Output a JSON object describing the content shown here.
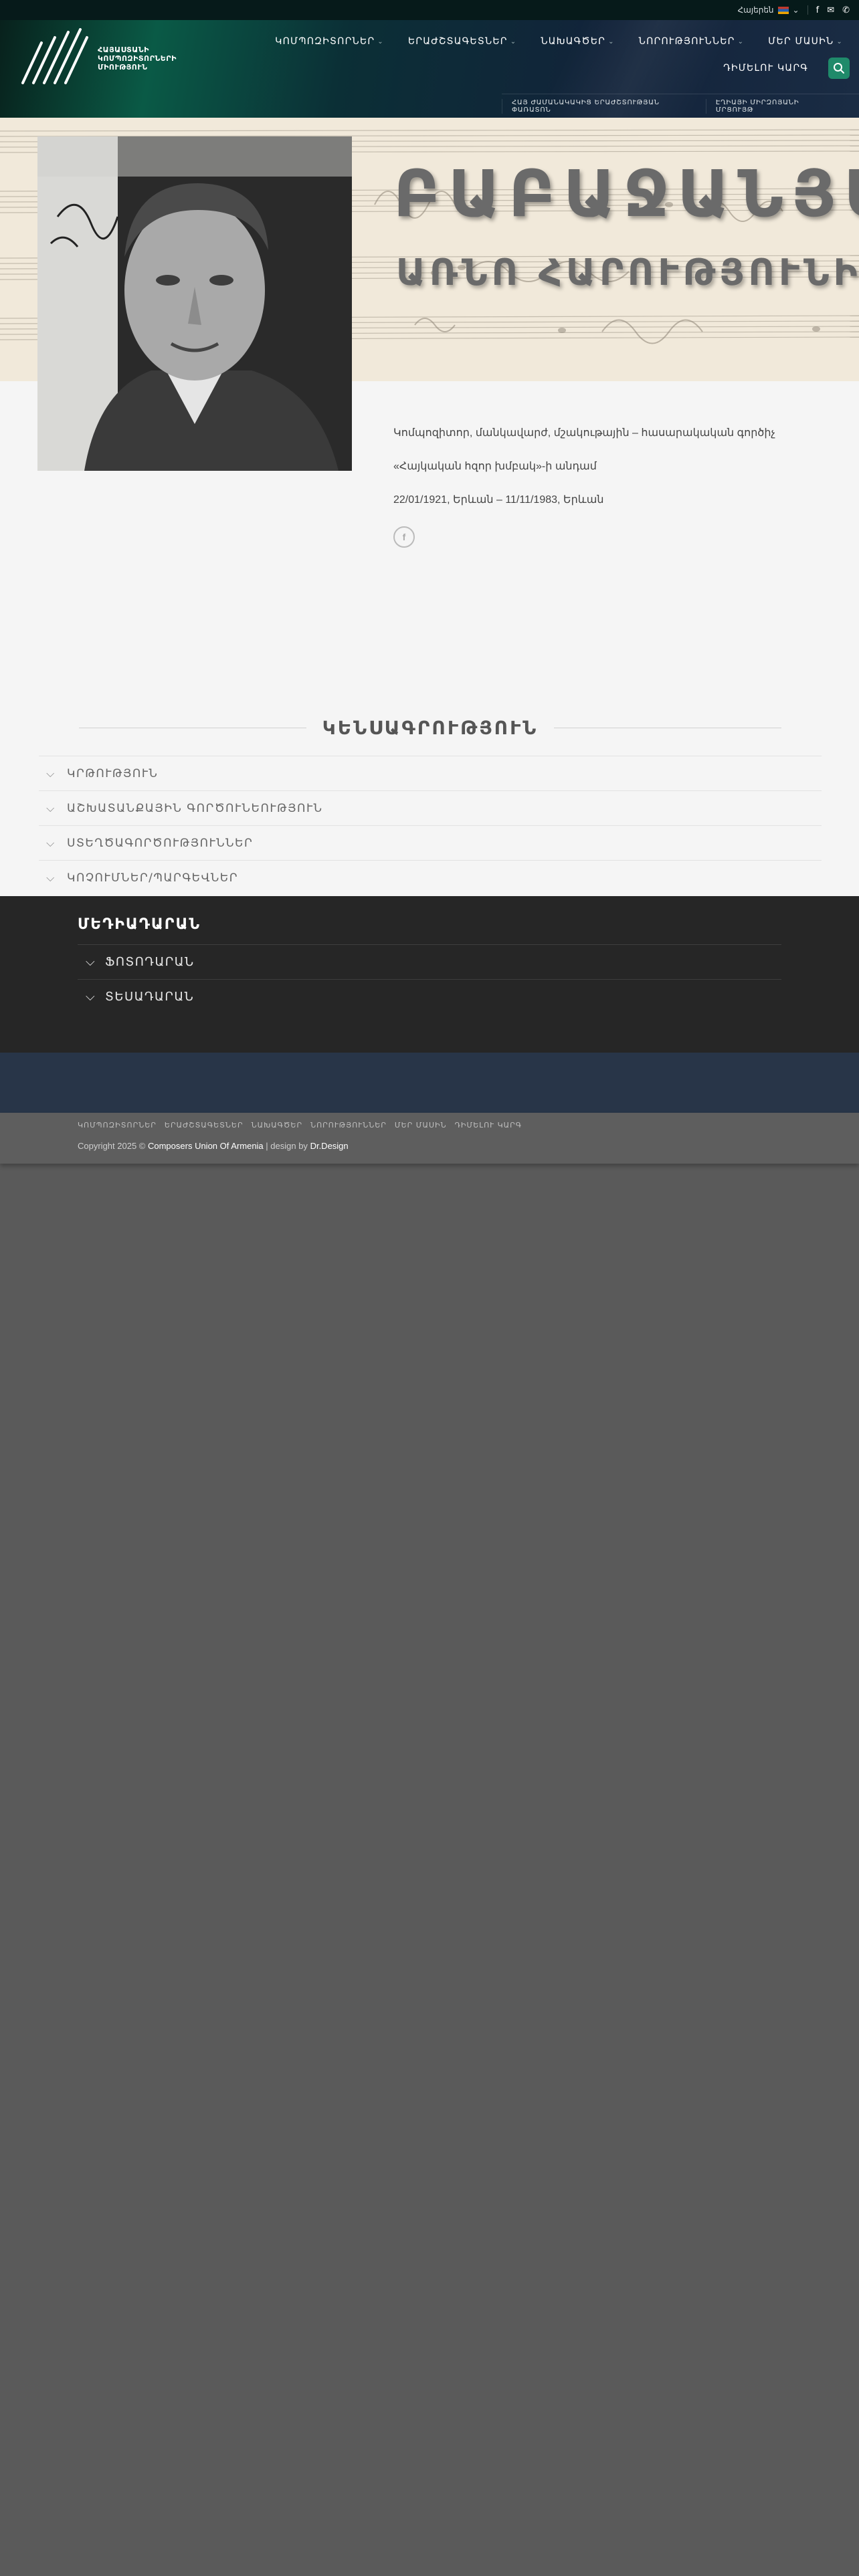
{
  "topbar": {
    "language": "Հայերեն",
    "icons": [
      "facebook-icon",
      "mail-icon",
      "phone-icon"
    ]
  },
  "logo": {
    "text_line1": "ՀԱՅԱՍՏԱՆԻ",
    "text_line2": "ԿՈՄՊՈԶԻՏՈՐՆԵՐԻ",
    "text_line3": "ՄԻՈՒԹՅՈՒՆ"
  },
  "nav": {
    "items": [
      {
        "label": "ԿՈՄՊՈԶԻՏՈՐՆԵՐ"
      },
      {
        "label": "ԵՐԱԺՇՏԱԳԵՏՆԵՐ"
      },
      {
        "label": "ՆԱԽԱԳԾԵՐ"
      },
      {
        "label": "ՆՈՐՈՒԹՅՈՒՆՆԵՐ"
      },
      {
        "label": "ՄԵՐ ՄԱՍԻՆ"
      }
    ],
    "contact_label": "ԴԻՄԵԼՈՒ ԿԱՐԳ",
    "subnav": [
      "ՀԱՅ ԺԱՄԱՆԱԿԱԿԻՑ ԵՐԱԺՇՏՈՒԹՅԱՆ ՓԱՌԱՏՈՆ",
      "ԷՂԻԱՅԻ ՄԻՐԶՈՅԱՆԻ ՄՐՑՈՒՅԹ"
    ]
  },
  "hero": {
    "surname": "ԲԱԲԱՋԱՆՅԱՆ",
    "given_name": "ԱՌՆՈ ՀԱՐՈՒԹՅՈՒՆԻ"
  },
  "info": {
    "line1": "Կոմպոզիտոր, մանկավարժ, մշակութային – հասարակական գործիչ",
    "line2": "«Հայկական հզոր խմբակ»-ի անդամ",
    "dates": "22/01/1921, Երևան – 11/11/1983, Երևան",
    "share_label": "f"
  },
  "biography": {
    "title": "ԿԵՆՍԱԳՐՈՒԹՅՈՒՆ",
    "sections": [
      {
        "label": "ԿՐԹՈՒԹՅՈՒՆ"
      },
      {
        "label": "ԱՇԽԱՏԱՆՔԱՅԻՆ ԳՈՐԾՈՒՆԵՈՒԹՅՈՒՆ"
      },
      {
        "label": "ՍՏԵՂԾԱԳՈՐԾՈՒԹՅՈՒՆՆԵՐ"
      },
      {
        "label": "ԿՈՉՈՒՄՆԵՐ/ՊԱՐԳԵՎՆԵՐ"
      }
    ]
  },
  "media": {
    "title": "ՄԵԴԻԱԴԱՐԱՆ",
    "sections": [
      {
        "label": "ՖՈՏՈԴԱՐԱՆ"
      },
      {
        "label": "ՏԵՍԱԴԱՐԱՆ"
      }
    ]
  },
  "footer": {
    "links": [
      "ԿՈՄՊՈԶԻՏՈՐՆԵՐ",
      "ԵՐԱԺՇՏԱԳԵՏՆԵՐ",
      "ՆԱԽԱԳԾԵՐ",
      "ՆՈՐՈՒԹՅՈՒՆՆԵՐ",
      "ՄԵՐ ՄԱՍԻՆ",
      "ԴԻՄԵԼՈՒ ԿԱՐԳ"
    ],
    "copyright_prefix": "Copyright 2025 ©",
    "copyright_org": "Composers Union Of Armenia",
    "copyright_sep": "| design by",
    "copyright_designer": "Dr.Design"
  },
  "colors": {
    "accent": "#1f8a6a",
    "header_dark": "#061a1a",
    "media_bg": "#262626",
    "band": "#283548",
    "footer_bg": "#5e5e5e"
  }
}
